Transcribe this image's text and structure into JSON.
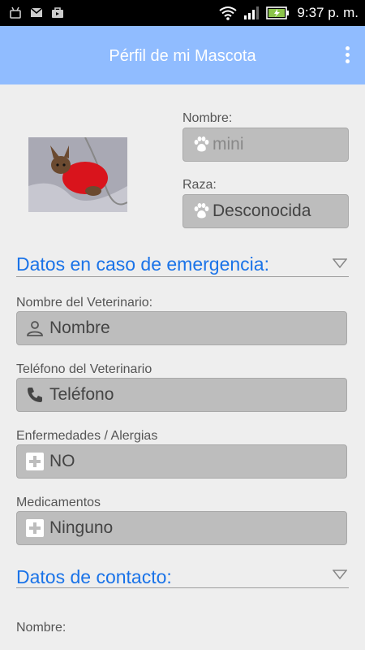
{
  "status_bar": {
    "time": "9:37 p. m."
  },
  "app_bar": {
    "title": "Pérfil de mi Mascota"
  },
  "pet": {
    "name_label": "Nombre:",
    "name_value": "mini",
    "breed_label": "Raza:",
    "breed_value": "Desconocida"
  },
  "emergency": {
    "section_title": "Datos en caso de emergencia:",
    "vet_name_label": "Nombre del Veterinario:",
    "vet_name_placeholder": "Nombre",
    "vet_phone_label": "Teléfono del Veterinario",
    "vet_phone_placeholder": "Teléfono",
    "diseases_label": "Enfermedades / Alergias",
    "diseases_value": "NO",
    "medications_label": "Medicamentos",
    "medications_value": "Ninguno"
  },
  "contact": {
    "section_title": "Datos de contacto:",
    "name_label": "Nombre:"
  },
  "colors": {
    "app_bar": "#90bcff",
    "section_title": "#1a73e8",
    "field_bg": "#bdbdbd"
  }
}
